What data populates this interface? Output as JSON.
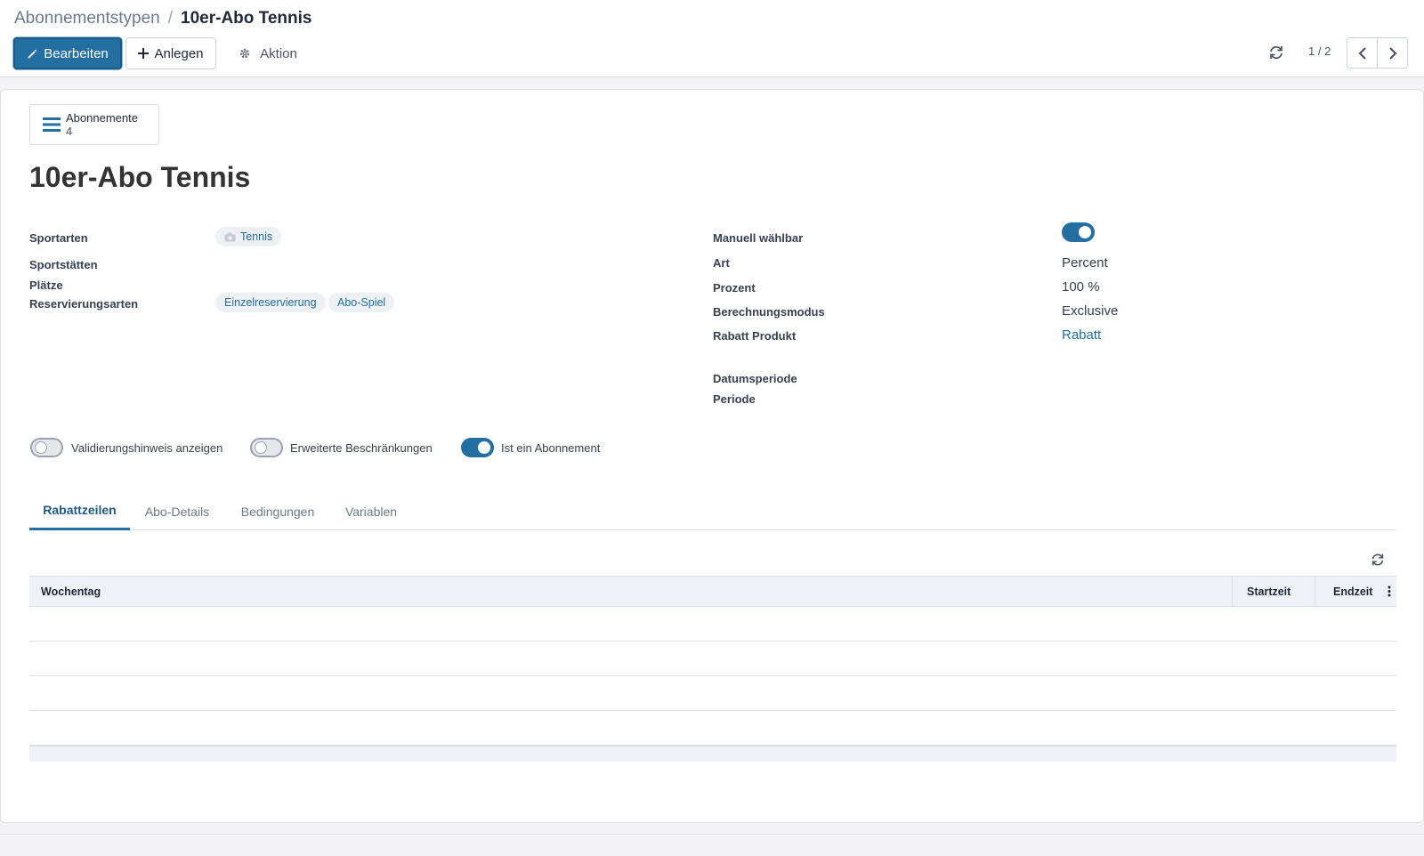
{
  "breadcrumb": {
    "parent": "Abonnementstypen",
    "separator": "/",
    "current": "10er-Abo Tennis"
  },
  "toolbar": {
    "edit_label": "Bearbeiten",
    "create_label": "Anlegen",
    "action_label": "Aktion"
  },
  "pager": {
    "value": "1 / 2"
  },
  "smart_button": {
    "label": "Abonnemente",
    "count": "4"
  },
  "record": {
    "title": "10er-Abo Tennis"
  },
  "left_fields": {
    "sportarten_label": "Sportarten",
    "sportarten_tags": [
      "Tennis"
    ],
    "sportstaetten_label": "Sportstätten",
    "plaetze_label": "Plätze",
    "reservierungsarten_label": "Reservierungsarten",
    "reservierungsarten_tags": [
      "Einzelreservierung",
      "Abo-Spiel"
    ]
  },
  "right_fields": {
    "manuell_label": "Manuell wählbar",
    "manuell_value": true,
    "art_label": "Art",
    "art_value": "Percent",
    "prozent_label": "Prozent",
    "prozent_value": "100 %",
    "berechnung_label": "Berechnungsmodus",
    "berechnung_value": "Exclusive",
    "rabatt_label": "Rabatt Produkt",
    "rabatt_value": "Rabatt",
    "datumsperiode_label": "Datumsperiode",
    "periode_label": "Periode"
  },
  "toggles": [
    {
      "label": "Validierungshinweis anzeigen",
      "on": false
    },
    {
      "label": "Erweiterte Beschränkungen",
      "on": false
    },
    {
      "label": "Ist ein Abonnement",
      "on": true
    }
  ],
  "tabs": [
    {
      "label": "Rabattzeilen",
      "active": true
    },
    {
      "label": "Abo-Details",
      "active": false
    },
    {
      "label": "Bedingungen",
      "active": false
    },
    {
      "label": "Variablen",
      "active": false
    }
  ],
  "table": {
    "columns": [
      "Wochentag",
      "Startzeit",
      "Endzeit"
    ],
    "rows": []
  },
  "colors": {
    "primary": "#236fa1",
    "text": "#374151",
    "border": "#dcdfe3"
  }
}
